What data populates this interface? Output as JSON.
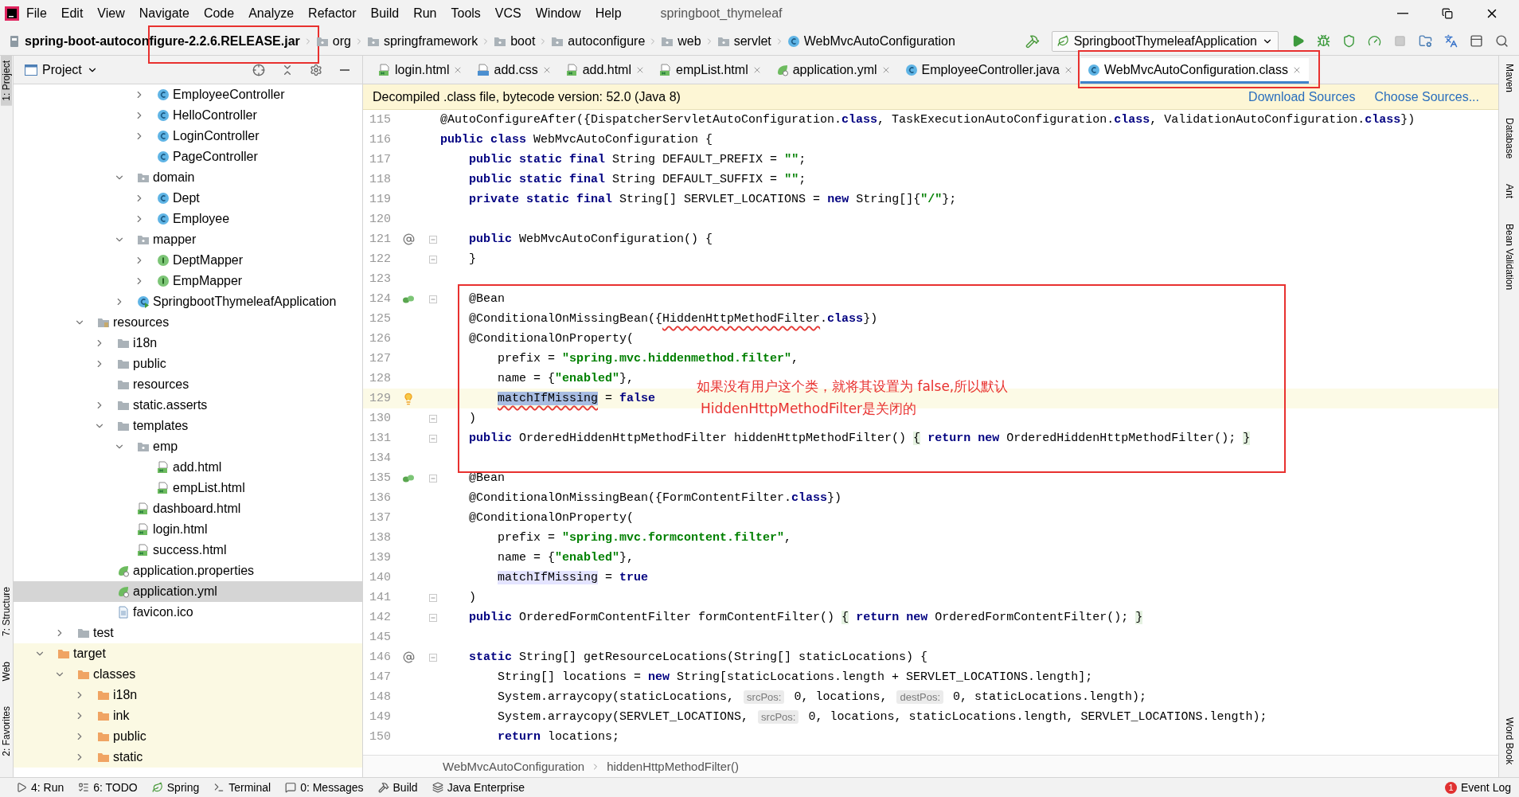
{
  "menu": {
    "items": [
      "File",
      "Edit",
      "View",
      "Navigate",
      "Code",
      "Analyze",
      "Refactor",
      "Build",
      "Run",
      "Tools",
      "VCS",
      "Window",
      "Help"
    ],
    "title": "springboot_thymeleaf"
  },
  "navbar": {
    "crumbs": [
      {
        "label": "spring-boot-autoconfigure-2.2.6.RELEASE.jar",
        "kind": "jar",
        "annotated": true
      },
      {
        "label": "org",
        "kind": "package",
        "annotated": false
      },
      {
        "label": "springframework",
        "kind": "package",
        "annotated": false
      },
      {
        "label": "boot",
        "kind": "package",
        "annotated": false
      },
      {
        "label": "autoconfigure",
        "kind": "package",
        "annotated": false
      },
      {
        "label": "web",
        "kind": "package",
        "annotated": false
      },
      {
        "label": "servlet",
        "kind": "package",
        "annotated": false
      },
      {
        "label": "WebMvcAutoConfiguration",
        "kind": "class",
        "annotated": false
      }
    ],
    "run_config": "SpringbootThymeleafApplication"
  },
  "left_strip": [
    {
      "label": "1: Project",
      "selected": true
    },
    {
      "label": "7: Structure",
      "selected": false
    },
    {
      "label": "Web",
      "selected": false
    },
    {
      "label": "2: Favorites",
      "selected": false
    }
  ],
  "right_strip": [
    "Maven",
    "Database",
    "Ant",
    "Bean Validation",
    "Word Book"
  ],
  "project": {
    "title": "Project",
    "tree": [
      {
        "children": [
          {
            "children": [
              {
                "children": [
                  {
                    "children": [
                      {
                        "children": [
                          {
                            "label": "EmployeeController",
                            "kind": "class",
                            "selected": false,
                            "expanded": false
                          },
                          {
                            "label": "HelloController",
                            "kind": "class",
                            "selected": false,
                            "expanded": false
                          },
                          {
                            "label": "LoginController",
                            "kind": "class",
                            "selected": false,
                            "expanded": false
                          },
                          {
                            "label": "PageController",
                            "kind": "class",
                            "selected": false
                          }
                        ]
                      },
                      {
                        "label": "domain",
                        "kind": "package",
                        "selected": false,
                        "expanded": true,
                        "children": [
                          {
                            "label": "Dept",
                            "kind": "class",
                            "selected": false,
                            "expanded": false
                          },
                          {
                            "label": "Employee",
                            "kind": "class",
                            "selected": false,
                            "expanded": false
                          }
                        ]
                      },
                      {
                        "label": "mapper",
                        "kind": "package",
                        "selected": false,
                        "expanded": true,
                        "children": [
                          {
                            "label": "DeptMapper",
                            "kind": "interface",
                            "selected": false,
                            "expanded": false
                          },
                          {
                            "label": "EmpMapper",
                            "kind": "interface",
                            "selected": false,
                            "expanded": false
                          }
                        ]
                      },
                      {
                        "label": "SpringbootThymeleafApplication",
                        "kind": "app",
                        "selected": false,
                        "expanded": false
                      }
                    ]
                  }
                ]
              },
              {
                "label": "resources",
                "kind": "resources",
                "selected": false,
                "expanded": true,
                "children": [
                  {
                    "label": "i18n",
                    "kind": "folder",
                    "selected": false,
                    "expanded": false
                  },
                  {
                    "label": "public",
                    "kind": "folder",
                    "selected": false,
                    "expanded": false
                  },
                  {
                    "label": "resources",
                    "kind": "folder",
                    "selected": false
                  },
                  {
                    "label": "static.asserts",
                    "kind": "folder",
                    "selected": false,
                    "expanded": false
                  },
                  {
                    "label": "templates",
                    "kind": "folder",
                    "selected": false,
                    "expanded": true,
                    "children": [
                      {
                        "label": "emp",
                        "kind": "package",
                        "selected": false,
                        "expanded": true,
                        "children": [
                          {
                            "label": "add.html",
                            "kind": "html",
                            "selected": false
                          },
                          {
                            "label": "empList.html",
                            "kind": "html",
                            "selected": false
                          }
                        ]
                      },
                      {
                        "label": "dashboard.html",
                        "kind": "html",
                        "selected": false
                      },
                      {
                        "label": "login.html",
                        "kind": "html",
                        "selected": false
                      },
                      {
                        "label": "success.html",
                        "kind": "html",
                        "selected": false
                      }
                    ]
                  },
                  {
                    "label": "application.properties",
                    "kind": "spring",
                    "selected": false
                  },
                  {
                    "label": "application.yml",
                    "kind": "spring",
                    "selected": true
                  },
                  {
                    "label": "favicon.ico",
                    "kind": "file",
                    "selected": false
                  }
                ]
              }
            ]
          },
          {
            "label": "test",
            "kind": "folder",
            "selected": false,
            "expanded": false
          }
        ]
      },
      {
        "label": "target",
        "kind": "excluded",
        "selected": false,
        "expanded": true,
        "children": [
          {
            "label": "classes",
            "kind": "excluded",
            "selected": false,
            "expanded": true,
            "children": [
              {
                "label": "i18n",
                "kind": "excluded",
                "selected": false,
                "expanded": false
              },
              {
                "label": "ink",
                "kind": "excluded",
                "selected": false,
                "expanded": false
              },
              {
                "label": "public",
                "kind": "excluded",
                "selected": false,
                "expanded": false
              },
              {
                "label": "static",
                "kind": "excluded",
                "selected": false,
                "expanded": false
              }
            ]
          }
        ]
      }
    ]
  },
  "tabs": [
    {
      "label": "login.html",
      "kind": "html",
      "selected": false,
      "annotated": false
    },
    {
      "label": "add.css",
      "kind": "css",
      "selected": false,
      "annotated": false
    },
    {
      "label": "add.html",
      "kind": "html",
      "selected": false,
      "annotated": false
    },
    {
      "label": "empList.html",
      "kind": "html",
      "selected": false,
      "annotated": false
    },
    {
      "label": "application.yml",
      "kind": "spring",
      "selected": false,
      "annotated": false
    },
    {
      "label": "EmployeeController.java",
      "kind": "class",
      "selected": false,
      "annotated": false
    },
    {
      "label": "WebMvcAutoConfiguration.class",
      "kind": "class",
      "selected": true,
      "annotated": true
    }
  ],
  "info_bar": {
    "message": "Decompiled .class file, bytecode version: 52.0 (Java 8)",
    "links": [
      "Download Sources",
      "Choose Sources..."
    ]
  },
  "editor": {
    "lines_before": [
      {
        "number": "115",
        "current": false,
        "kind": "top",
        "segments": [
          {
            "text": "@AutoConfigureAfter({DispatcherServletAutoConfiguration.class, TaskExecutionAutoConfiguration.class, ValidationAutoConfiguration.class})"
          }
        ]
      },
      {
        "number": "116",
        "current": false,
        "kind": "top",
        "segments": [
          {
            "text": "public class WebMvcAutoConfiguration {"
          }
        ]
      },
      {
        "number": "117",
        "current": false,
        "kind": "member",
        "segments": [
          {
            "text": "public static final String DEFAULT_PREFIX = \"\";"
          }
        ]
      },
      {
        "number": "118",
        "current": false,
        "kind": "member",
        "segments": [
          {
            "text": "public static final String DEFAULT_SUFFIX = \"\";"
          }
        ]
      },
      {
        "number": "119",
        "current": false,
        "kind": "member",
        "segments": [
          {
            "text": "private static final String[] SERVLET_LOCATIONS = new String[]{\"/\"};"
          }
        ]
      },
      {
        "number": "120",
        "current": false
      },
      {
        "number": "121",
        "current": false,
        "kind": "member",
        "gutter": {
          "kind": "at"
        },
        "fold": true,
        "segments": [
          {
            "text": "public WebMvcAutoConfiguration() {"
          }
        ]
      },
      {
        "number": "122",
        "current": false,
        "kind": "member",
        "fold": true,
        "segments": [
          {
            "text": "}"
          }
        ]
      },
      {
        "number": "123",
        "current": false
      }
    ],
    "annotation": {
      "note": [
        "如果没有用户这个类，就将其设置为 false,所以默认",
        "HiddenHttpMethodFilter是关闭的"
      ],
      "lines": [
        {
          "number": "124",
          "current": false,
          "kind": "member",
          "gutter": {
            "kind": "bean"
          },
          "fold": true,
          "segments": [
            {
              "text": "@Bean"
            }
          ]
        },
        {
          "number": "125",
          "current": false,
          "kind": "member",
          "segments": [
            {
              "text": "@ConditionalOnMissingBean({"
            },
            {
              "text": "HiddenHttpMethodFilter",
              "underlined": true
            },
            {
              "text": ".class})"
            }
          ]
        },
        {
          "number": "126",
          "current": false,
          "kind": "member",
          "segments": [
            {
              "text": "@ConditionalOnProperty("
            }
          ]
        },
        {
          "number": "127",
          "current": false,
          "kind": "nested",
          "segments": [
            {
              "text": "prefix = \"spring.mvc.hiddenmethod.filter\","
            }
          ]
        },
        {
          "number": "128",
          "current": false,
          "kind": "nested",
          "segments": [
            {
              "text": "name = {\"enabled\"},"
            }
          ]
        },
        {
          "number": "129",
          "current": true,
          "kind": "nested",
          "gutter": {
            "kind": "bulb"
          },
          "segments": [
            {
              "text": "matchIfMissing",
              "kind": "selection",
              "underlined": true
            },
            {
              "text": " = false"
            }
          ]
        },
        {
          "number": "130",
          "current": false,
          "kind": "member",
          "fold": true,
          "segments": [
            {
              "text": ")"
            }
          ]
        },
        {
          "number": "131",
          "current": false,
          "kind": "member",
          "fold": true,
          "segments": [
            {
              "text": "public OrderedHiddenHttpMethodFilter hiddenHttpMethodFilter() "
            },
            {
              "text": "{",
              "kind": "fold"
            },
            {
              "text": " return new OrderedHiddenHttpMethodFilter(); "
            },
            {
              "text": "}",
              "kind": "fold"
            }
          ]
        },
        {
          "number": "134",
          "current": false
        }
      ]
    },
    "lines_after": [
      {
        "number": "135",
        "current": false,
        "kind": "member",
        "gutter": {
          "kind": "bean"
        },
        "fold": true,
        "segments": [
          {
            "text": "@Bean"
          }
        ]
      },
      {
        "number": "136",
        "current": false,
        "kind": "member",
        "segments": [
          {
            "text": "@ConditionalOnMissingBean({FormContentFilter.class})"
          }
        ]
      },
      {
        "number": "137",
        "current": false,
        "kind": "member",
        "segments": [
          {
            "text": "@ConditionalOnProperty("
          }
        ]
      },
      {
        "number": "138",
        "current": false,
        "kind": "nested",
        "segments": [
          {
            "text": "prefix = \"spring.mvc.formcontent.filter\","
          }
        ]
      },
      {
        "number": "139",
        "current": false,
        "kind": "nested",
        "segments": [
          {
            "text": "name = {\"enabled\"},"
          }
        ]
      },
      {
        "number": "140",
        "current": false,
        "kind": "nested",
        "segments": [
          {
            "text": "matchIfMissing",
            "kind": "usage"
          },
          {
            "text": " = true"
          }
        ]
      },
      {
        "number": "141",
        "current": false,
        "kind": "member",
        "fold": true,
        "segments": [
          {
            "text": ")"
          }
        ]
      },
      {
        "number": "142",
        "current": false,
        "kind": "member",
        "fold": true,
        "segments": [
          {
            "text": "public OrderedFormContentFilter formContentFilter() "
          },
          {
            "text": "{",
            "kind": "fold"
          },
          {
            "text": " return new OrderedFormContentFilter(); "
          },
          {
            "text": "}",
            "kind": "fold"
          }
        ]
      },
      {
        "number": "145",
        "current": false
      },
      {
        "number": "146",
        "current": false,
        "kind": "member",
        "gutter": {
          "kind": "at"
        },
        "fold": true,
        "segments": [
          {
            "text": "static String[] getResourceLocations(String[] staticLocations) {"
          }
        ]
      },
      {
        "number": "147",
        "current": false,
        "kind": "nested",
        "segments": [
          {
            "text": "String[] locations = new String[staticLocations.length + SERVLET_LOCATIONS.length];"
          }
        ]
      },
      {
        "number": "148",
        "current": false,
        "kind": "nested",
        "segments": [
          {
            "text": "System.arraycopy(staticLocations, "
          },
          {
            "text": "srcPos:",
            "kind": "hint"
          },
          {
            "text": " 0, locations, "
          },
          {
            "text": "destPos:",
            "kind": "hint"
          },
          {
            "text": " 0, staticLocations.length);"
          }
        ]
      },
      {
        "number": "149",
        "current": false,
        "kind": "nested",
        "segments": [
          {
            "text": "System.arraycopy(SERVLET_LOCATIONS, "
          },
          {
            "text": "srcPos:",
            "kind": "hint"
          },
          {
            "text": " 0, locations, staticLocations.length, SERVLET_LOCATIONS.length);"
          }
        ]
      },
      {
        "number": "150",
        "current": false,
        "kind": "nested",
        "segments": [
          {
            "text": "return locations;"
          }
        ]
      }
    ]
  },
  "breadcrumbs": [
    "WebMvcAutoConfiguration",
    "hiddenHttpMethodFilter()"
  ],
  "bottom_bar": {
    "tools": [
      {
        "label": "4: Run",
        "kind": "run"
      },
      {
        "label": "6: TODO",
        "kind": "todo"
      },
      {
        "label": "Spring",
        "kind": "spring"
      },
      {
        "label": "Terminal",
        "kind": "terminal"
      },
      {
        "label": "0: Messages",
        "kind": "messages"
      },
      {
        "label": "Build",
        "kind": "build"
      },
      {
        "label": "Java Enterprise",
        "kind": "enterprise"
      }
    ],
    "event_log": {
      "label": "Event Log",
      "badge": "1"
    }
  }
}
